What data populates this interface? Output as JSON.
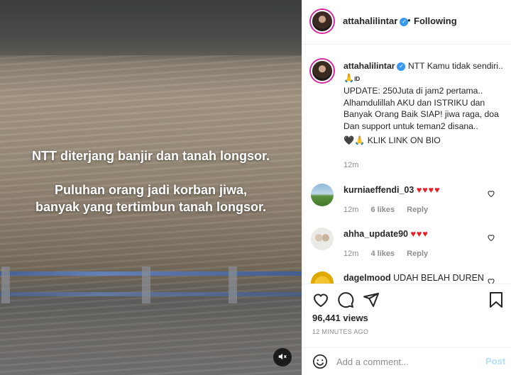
{
  "video": {
    "overlay_line1": "NTT diterjang banjir dan tanah longsor.",
    "overlay_line2": "Puluhan orang jadi korban jiwa,",
    "overlay_line3": "banyak yang tertimbun tanah longsor.",
    "mute_icon": "speaker-muted-icon"
  },
  "header": {
    "username": "attahalilintar",
    "verified_mark": "✓",
    "separator": "•",
    "follow_state": "Following"
  },
  "caption": {
    "username": "attahalilintar",
    "text_first": "NTT Kamu tidak sendiri..🙏",
    "id_tag": "ID",
    "line2": "UPDATE: 250Juta di jam2 pertama..",
    "line3": "Alhamdulillah AKU dan ISTRIKU dan Banyak Orang Baik SIAP! jiwa raga, doa Dan support untuk teman2 disana..",
    "line4": "🖤🙏 KLIK LINK ON BIO",
    "time": "12m"
  },
  "comments": [
    {
      "username": "kurniaeffendi_03",
      "text": "♥♥♥♥",
      "time": "12m",
      "likes": "6 likes",
      "reply": "Reply"
    },
    {
      "username": "ahha_update90",
      "text": "♥♥♥",
      "time": "12m",
      "likes": "4 likes",
      "reply": "Reply"
    },
    {
      "username": "dagelmood",
      "text": "UDAH BELAH DUREN"
    }
  ],
  "stats": {
    "views": "96,441 views",
    "posted": "12 MINUTES AGO"
  },
  "add_comment": {
    "placeholder": "Add a comment...",
    "post_label": "Post"
  },
  "colors": {
    "verified": "#3897f0",
    "story_ring": "#d6249f",
    "post_disabled": "#b2dffc",
    "heart_red": "#ed1c24"
  }
}
